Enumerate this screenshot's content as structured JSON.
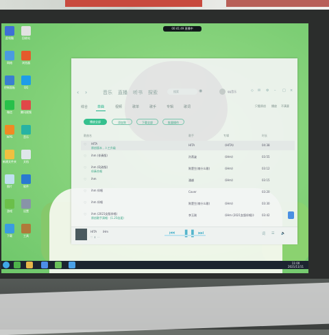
{
  "notification": {
    "time": "00:41:49",
    "text": "直播中"
  },
  "window": {
    "nav": [
      "音乐",
      "直播",
      "听书",
      "探索"
    ],
    "search_placeholder": "搜索",
    "user_name": "qq音乐",
    "tabs": [
      "综合",
      "单曲",
      "视频",
      "歌单",
      "歌手",
      "专辑",
      "歌词"
    ],
    "active_tab": "单曲",
    "top_links": [
      "只看原创",
      "播放",
      "不满意"
    ],
    "actions": {
      "play_all": "播放全部",
      "add": "添加到",
      "download": "下载全部",
      "batch": "批量操作"
    },
    "columns": {
      "song": "歌曲名",
      "artist": "歌手",
      "album": "专辑",
      "duration": "时长"
    },
    "songs": [
      {
        "title": "HITA",
        "sub": "原创版本 ,   人工升级",
        "artist": "HITA",
        "album": "《HITA》",
        "duration": "04:38"
      },
      {
        "title": "ihm (伴奏版)",
        "sub": "",
        "artist": "孙燕姿",
        "album": "《iHm》",
        "duration": "03:55"
      },
      {
        "title": "ihm (DJ改版)",
        "sub": "伴奏合唱",
        "artist": "陈楚生(南什么歌)",
        "album": "《iHm》",
        "duration": "03:12"
      },
      {
        "title": "ihm",
        "sub": "",
        "artist": "潘越",
        "album": "《iHm》",
        "duration": "03:15"
      },
      {
        "title": "ihm 伴唱",
        "sub": "",
        "artist": "Cover",
        "album": "",
        "duration": "03:20"
      },
      {
        "title": "ihm 伴唱",
        "sub": "",
        "artist": "陈楚生(南什么歌)",
        "album": "《iHm》",
        "duration": "03:30"
      },
      {
        "title": "ihm (2021女版伴唱)",
        "sub": "原创歌手演唱 · (1.25倍速)",
        "artist": "李玉刚",
        "album": "《iHm (2021女版伴唱)》",
        "duration": "03:42"
      }
    ],
    "player": {
      "title": "HITA",
      "artist": "iHm"
    }
  },
  "desktop_icons": [
    "此电脑",
    "回收站",
    "网络",
    "浏览器",
    "控制面板",
    "QQ",
    "微信",
    "腾讯视频",
    "WPS",
    "音乐",
    "新建文件夹",
    "文档",
    "图片",
    "软件",
    "游戏",
    "设置",
    "下载",
    "工具"
  ],
  "taskbar": {
    "time": "11:00",
    "date": "2021/11/11"
  },
  "colors": {
    "accent": "#35c08e",
    "screen": "#87d37c",
    "taskbar": "#1c2430"
  }
}
